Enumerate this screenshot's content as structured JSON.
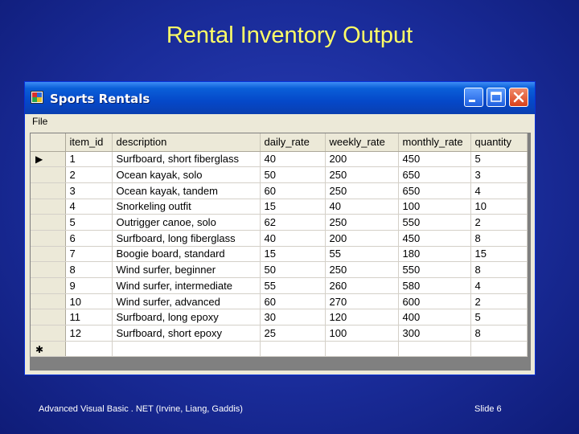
{
  "slide": {
    "title": "Rental Inventory Output",
    "footer_left": "Advanced Visual Basic . NET (Irvine, Liang, Gaddis)",
    "footer_right": "Slide 6"
  },
  "window": {
    "title": "Sports Rentals",
    "menu": [
      "File"
    ],
    "buttons": {
      "minimize": "minimize-icon",
      "maximize": "maximize-icon",
      "close": "close-icon"
    }
  },
  "grid": {
    "columns": [
      "item_id",
      "description",
      "daily_rate",
      "weekly_rate",
      "monthly_rate",
      "quantity"
    ],
    "current_row_marker": "▶",
    "new_row_marker": "✱",
    "rows": [
      [
        "1",
        "Surfboard, short fiberglass",
        "40",
        "200",
        "450",
        "5"
      ],
      [
        "2",
        "Ocean kayak, solo",
        "50",
        "250",
        "650",
        "3"
      ],
      [
        "3",
        "Ocean kayak, tandem",
        "60",
        "250",
        "650",
        "4"
      ],
      [
        "4",
        "Snorkeling outfit",
        "15",
        "40",
        "100",
        "10"
      ],
      [
        "5",
        "Outrigger canoe, solo",
        "62",
        "250",
        "550",
        "2"
      ],
      [
        "6",
        "Surfboard, long fiberglass",
        "40",
        "200",
        "450",
        "8"
      ],
      [
        "7",
        "Boogie board, standard",
        "15",
        "55",
        "180",
        "15"
      ],
      [
        "8",
        "Wind surfer, beginner",
        "50",
        "250",
        "550",
        "8"
      ],
      [
        "9",
        "Wind surfer, intermediate",
        "55",
        "260",
        "580",
        "4"
      ],
      [
        "10",
        "Wind surfer, advanced",
        "60",
        "270",
        "600",
        "2"
      ],
      [
        "11",
        "Surfboard, long epoxy",
        "30",
        "120",
        "400",
        "5"
      ],
      [
        "12",
        "Surfboard, short epoxy",
        "25",
        "100",
        "300",
        "8"
      ]
    ]
  },
  "colors": {
    "slide_title": "#ffff66",
    "titlebar": "#0548c9",
    "window_bg": "#ece9d8"
  }
}
